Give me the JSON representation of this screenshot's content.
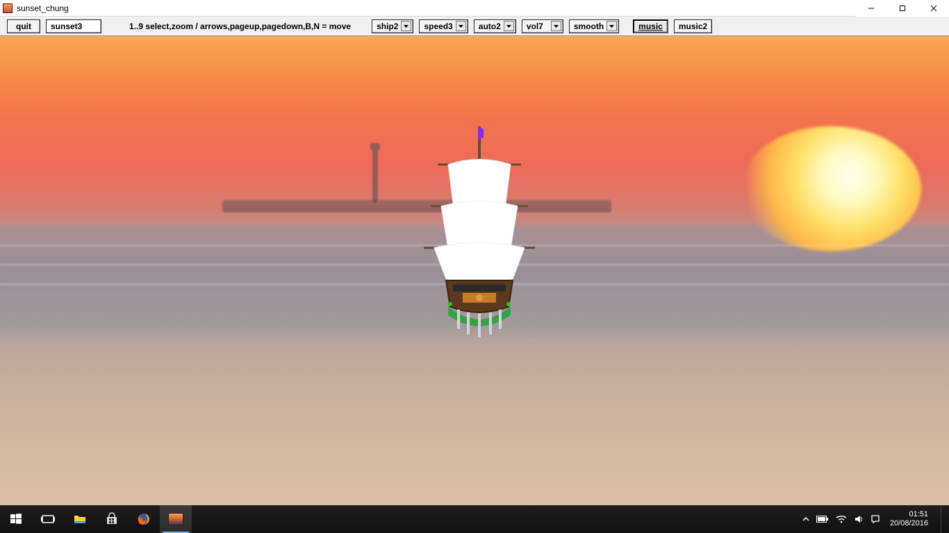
{
  "window": {
    "title": "sunset_chung",
    "controls": {
      "minimize": "—",
      "maximize": "☐",
      "close": "✕"
    }
  },
  "toolbar": {
    "quit_label": "quit",
    "scene_label": "sunset3",
    "hint": "1..9 select,zoom / arrows,pageup,pagedown,B,N = move",
    "dropdowns": {
      "ship": "ship2",
      "speed": "speed3",
      "auto": "auto2",
      "vol": "vol7",
      "smooth": "smooth"
    },
    "music_active": "music",
    "music2": "music2"
  },
  "taskbar": {
    "clock_time": "01:51",
    "clock_date": "20/08/2016",
    "tray": {
      "chevron": "chevron-up-icon",
      "battery": "battery-icon",
      "wifi": "wifi-icon",
      "volume": "volume-icon",
      "action": "action-center-icon"
    },
    "items": [
      {
        "name": "start",
        "icon": "windows-icon"
      },
      {
        "name": "taskview",
        "icon": "taskview-icon"
      },
      {
        "name": "explorer",
        "icon": "folder-icon"
      },
      {
        "name": "store",
        "icon": "store-icon"
      },
      {
        "name": "firefox",
        "icon": "firefox-icon"
      },
      {
        "name": "sunset-chung",
        "icon": "app-icon",
        "active": true
      }
    ]
  }
}
